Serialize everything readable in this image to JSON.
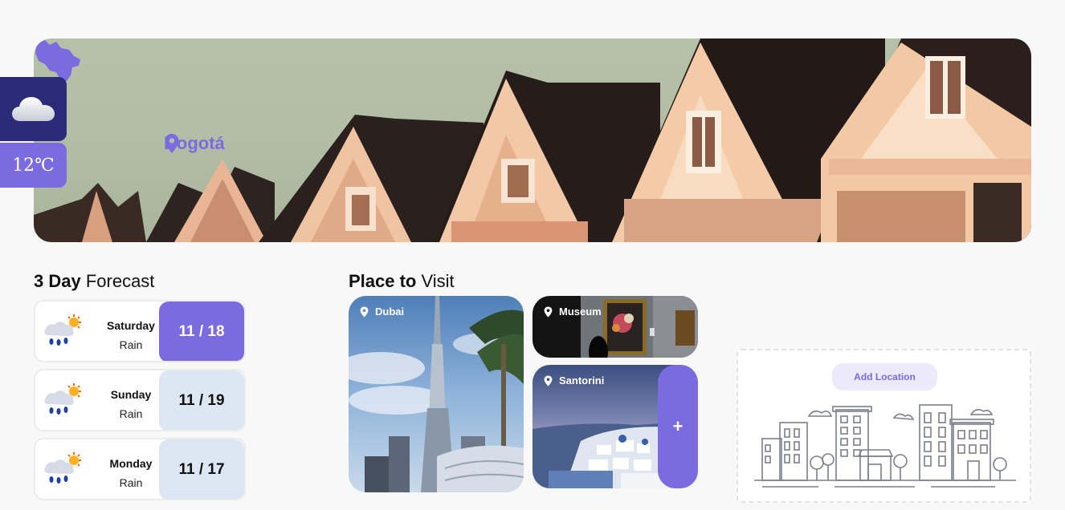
{
  "weather": {
    "icon": "cloud-icon",
    "temperature": "12℃"
  },
  "hero": {
    "location": "Bogotá",
    "location_icon": "map-pin-icon"
  },
  "forecast": {
    "title_bold": "3 Day",
    "title_rest": " Forecast",
    "days": [
      {
        "day": "Saturday",
        "condition": "Rain",
        "temps": "11 / 18",
        "active": true
      },
      {
        "day": "Sunday",
        "condition": "Rain",
        "temps": "11 / 19",
        "active": false
      },
      {
        "day": "Monday",
        "condition": "Rain",
        "temps": "11 / 17",
        "active": false
      }
    ]
  },
  "places": {
    "title_bold": "Place to",
    "title_rest": " Visit",
    "items": [
      {
        "name": "Dubai"
      },
      {
        "name": "Museum"
      },
      {
        "name": "Santorini"
      }
    ],
    "add_label": "+"
  },
  "add_location": {
    "label": "Add Location"
  },
  "colors": {
    "accent": "#7b6ae0",
    "dark": "#2b2b7a",
    "idle": "#dde7f3"
  }
}
